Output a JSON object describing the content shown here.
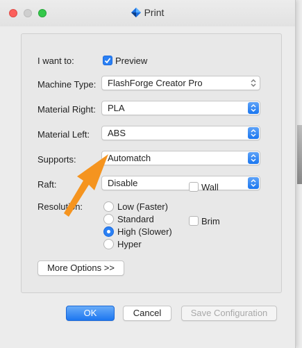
{
  "window": {
    "title": "Print"
  },
  "form": {
    "i_want_to": {
      "label": "I want to:",
      "option_label": "Preview",
      "checked": true
    },
    "machine_type": {
      "label": "Machine Type:",
      "value": "FlashForge Creator Pro"
    },
    "material_right": {
      "label": "Material Right:",
      "value": "PLA"
    },
    "material_left": {
      "label": "Material Left:",
      "value": "ABS"
    },
    "supports": {
      "label": "Supports:",
      "value": "Automatch"
    },
    "raft": {
      "label": "Raft:",
      "value": "Disable"
    },
    "resolution": {
      "label": "Resolution:",
      "options": [
        {
          "label": "Low (Faster)",
          "selected": false
        },
        {
          "label": "Standard",
          "selected": false
        },
        {
          "label": "High (Slower)",
          "selected": true
        },
        {
          "label": "Hyper",
          "selected": false
        }
      ]
    },
    "extras": [
      {
        "label": "Wall",
        "checked": false
      },
      {
        "label": "Brim",
        "checked": false
      }
    ],
    "more_options_label": "More Options >>"
  },
  "footer": {
    "ok_label": "OK",
    "cancel_label": "Cancel",
    "save_label": "Save Configuration"
  },
  "colors": {
    "accent": "#2b80f3",
    "annotation_arrow": "#f5941f"
  },
  "icons": [
    "app-logo-icon",
    "checkmark-icon",
    "updown-chevron-icon",
    "annotation-arrow-icon"
  ]
}
